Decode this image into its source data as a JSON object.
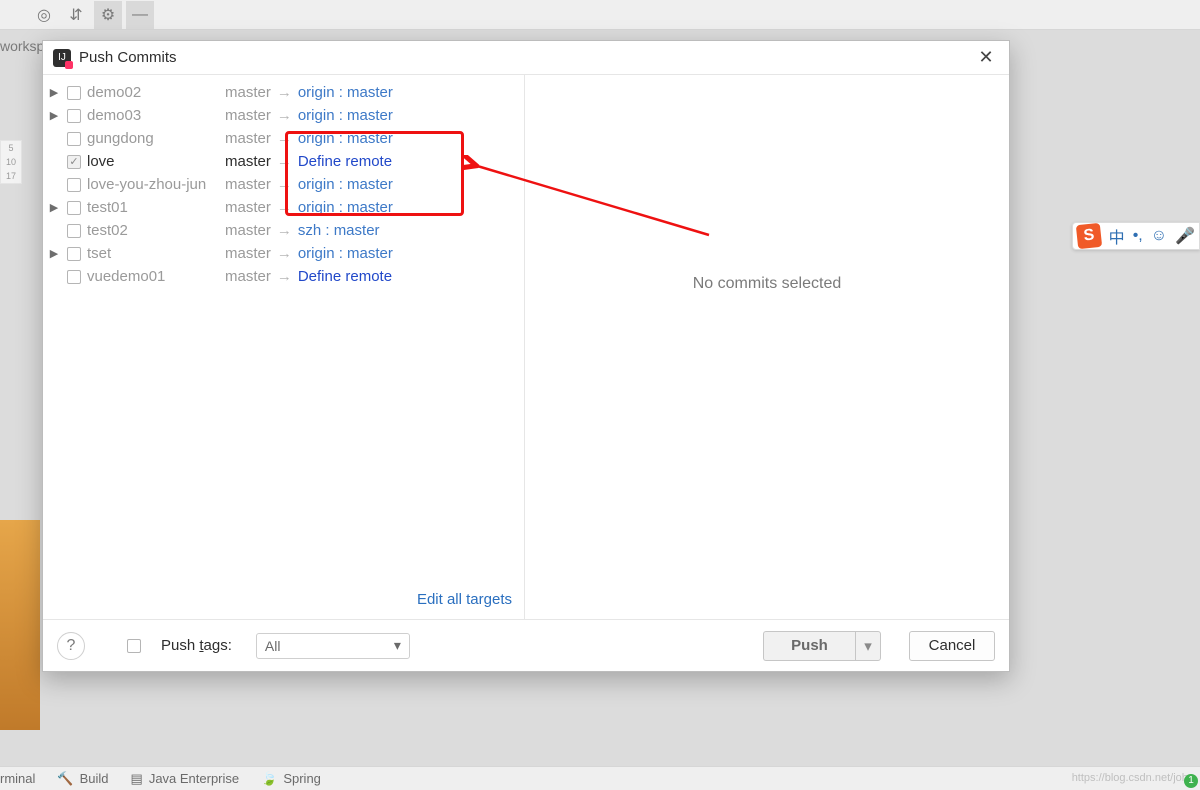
{
  "bg": {
    "workspace_label": "worksp",
    "ruler": [
      "5",
      "10",
      "17"
    ],
    "bottom_tabs": [
      "rminal",
      "Build",
      "Java Enterprise",
      "Spring"
    ],
    "watermark": "https://blog.csdn.net/john"
  },
  "ime": {
    "logo": "S",
    "lang": "中",
    "dot": "•,",
    "face": "☺",
    "mic": "🎤"
  },
  "dialog": {
    "title": "Push Commits",
    "rows": [
      {
        "arrow": true,
        "checked": false,
        "name": "demo02",
        "branch": "master",
        "remote": "origin : master",
        "define": false,
        "sel": false
      },
      {
        "arrow": true,
        "checked": false,
        "name": "demo03",
        "branch": "master",
        "remote": "origin : master",
        "define": false,
        "sel": false
      },
      {
        "arrow": false,
        "checked": false,
        "name": "gungdong",
        "branch": "master",
        "remote": "origin : master",
        "define": false,
        "sel": false
      },
      {
        "arrow": false,
        "checked": true,
        "name": "love",
        "branch": "master",
        "remote": "Define remote",
        "define": true,
        "sel": true
      },
      {
        "arrow": false,
        "checked": false,
        "name": "love-you-zhou-jun",
        "branch": "master",
        "remote": "origin : master",
        "define": false,
        "sel": false
      },
      {
        "arrow": true,
        "checked": false,
        "name": "test01",
        "branch": "master",
        "remote": "origin : master",
        "define": false,
        "sel": false
      },
      {
        "arrow": false,
        "checked": false,
        "name": "test02",
        "branch": "master",
        "remote": "szh : master",
        "define": false,
        "sel": false
      },
      {
        "arrow": true,
        "checked": false,
        "name": "tset",
        "branch": "master",
        "remote": "origin : master",
        "define": false,
        "sel": false
      },
      {
        "arrow": false,
        "checked": false,
        "name": "vuedemo01",
        "branch": "master",
        "remote": "Define remote",
        "define": true,
        "sel": false
      }
    ],
    "edit_all": "Edit all targets",
    "right_msg": "No commits selected",
    "footer": {
      "push_tags_label": "Push tags:",
      "tags_select": "All",
      "push": "Push",
      "cancel": "Cancel"
    }
  }
}
